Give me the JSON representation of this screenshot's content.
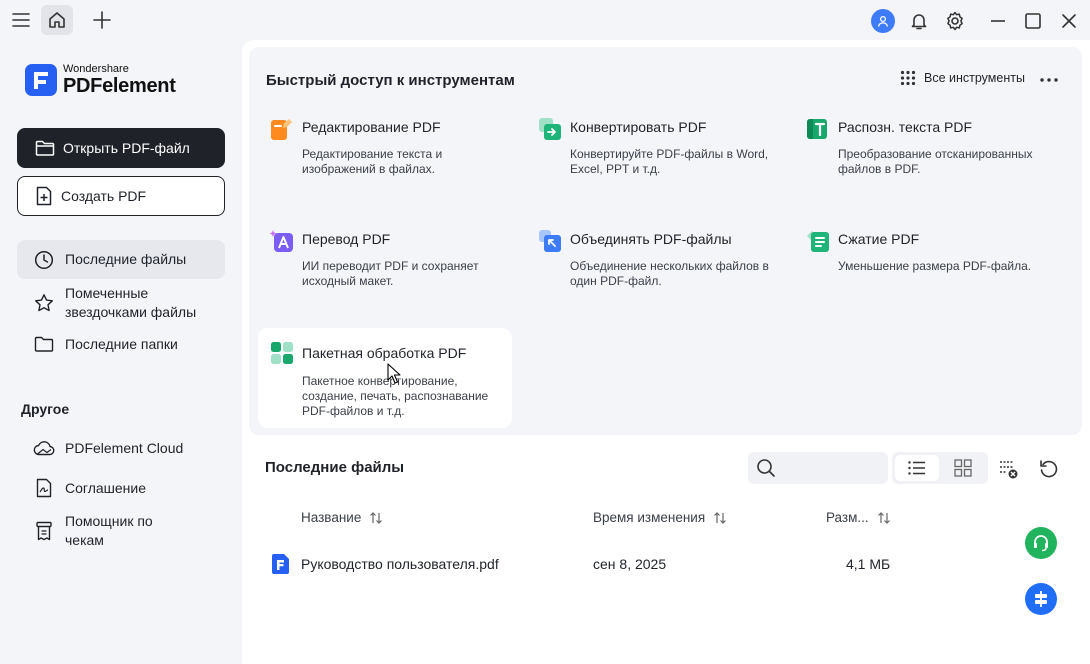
{
  "app": {
    "logo_small": "Wondershare",
    "logo_big": "PDFelement",
    "brand_color": "#2660f2"
  },
  "sidebar": {
    "open_button": "Открыть PDF-файл",
    "create_button": "Создать PDF",
    "nav": [
      {
        "label": "Последние файлы",
        "icon": "clock-icon",
        "active": true
      },
      {
        "label": "Помеченные звездочками файлы",
        "icon": "star-icon",
        "active": false
      },
      {
        "label": "Последние папки",
        "icon": "folder-icon",
        "active": false
      }
    ],
    "other_title": "Другое",
    "other": [
      {
        "label": "PDFelement Cloud",
        "icon": "cloud-icon"
      },
      {
        "label": "Соглашение",
        "icon": "agreement-icon"
      },
      {
        "label": "Помощник по чекам",
        "icon": "receipt-icon"
      }
    ]
  },
  "quick_access": {
    "title": "Быстрый доступ к инструментам",
    "all_tools": "Все инструменты",
    "cards": [
      {
        "title": "Редактирование PDF",
        "desc": "Редактирование текста и изображений в файлах.",
        "icon": "edit-pdf-icon"
      },
      {
        "title": "Конвертировать PDF",
        "desc": "Конвертируйте PDF-файлы в Word, Excel, PPT и т.д.",
        "icon": "convert-pdf-icon"
      },
      {
        "title": "Распозн. текста PDF",
        "desc": "Преобразование отсканированных файлов в PDF.",
        "icon": "ocr-icon"
      },
      {
        "title": "Перевод PDF",
        "desc": "ИИ переводит PDF и сохраняет исходный макет.",
        "icon": "translate-icon"
      },
      {
        "title": "Объединять PDF-файлы",
        "desc": "Объединение нескольких файлов в один PDF-файл.",
        "icon": "merge-icon"
      },
      {
        "title": "Сжатие PDF",
        "desc": "Уменьшение размера PDF-файла.",
        "icon": "compress-icon"
      },
      {
        "title": "Пакетная обработка PDF",
        "desc": "Пакетное конвертирование, создание, печать, распознавание PDF-файлов и т.д.",
        "icon": "batch-icon"
      }
    ]
  },
  "recent": {
    "title": "Последние файлы",
    "search_placeholder": "",
    "columns": [
      "Название",
      "Время изменения",
      "Разм..."
    ],
    "rows": [
      {
        "name": "Руководство пользователя.pdf",
        "modified": "сен 8, 2025",
        "size": "4,1 МБ"
      }
    ]
  }
}
